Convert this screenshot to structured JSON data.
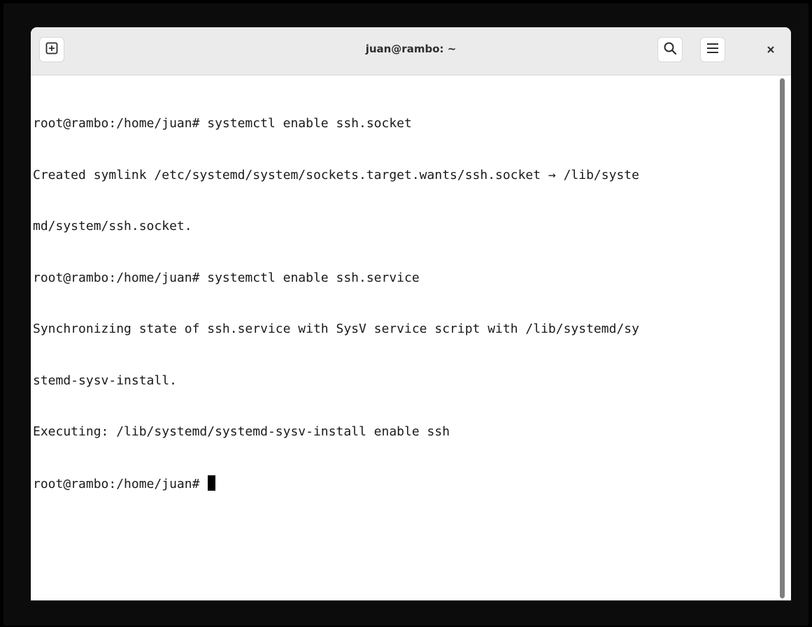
{
  "window": {
    "title": "juan@rambo: ~"
  },
  "headerbar": {
    "new_tab_icon": "new-tab-icon",
    "search_icon": "search-icon",
    "menu_icon": "hamburger-menu-icon",
    "close_icon": "close-icon"
  },
  "terminal": {
    "lines": [
      "root@rambo:/home/juan# systemctl enable ssh.socket",
      "Created symlink /etc/systemd/system/sockets.target.wants/ssh.socket → /lib/syste",
      "md/system/ssh.socket.",
      "root@rambo:/home/juan# systemctl enable ssh.service",
      "Synchronizing state of ssh.service with SysV service script with /lib/systemd/sy",
      "stemd-sysv-install.",
      "Executing: /lib/systemd/systemd-sysv-install enable ssh"
    ],
    "prompt": "root@rambo:/home/juan# "
  },
  "colors": {
    "headerbar_bg": "#ebebeb",
    "terminal_bg": "#ffffff",
    "terminal_fg": "#1a1a1a",
    "scrollbar": "#7f7f7f"
  }
}
